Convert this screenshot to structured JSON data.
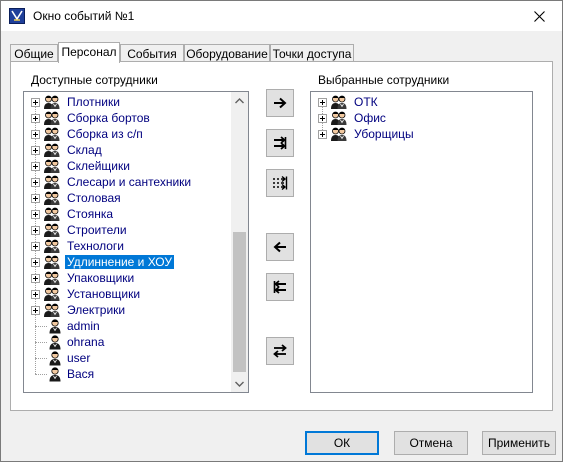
{
  "window": {
    "title": "Окно событий №1"
  },
  "tabs": [
    {
      "label": "Общие"
    },
    {
      "label": "Персонал"
    },
    {
      "label": "События"
    },
    {
      "label": "Оборудование"
    },
    {
      "label": "Точки доступа"
    }
  ],
  "active_tab": "Персонал",
  "available": {
    "label": "Доступные сотрудники",
    "groups": [
      {
        "label": "Плотники"
      },
      {
        "label": "Сборка бортов"
      },
      {
        "label": "Сборка из с/п"
      },
      {
        "label": "Склад"
      },
      {
        "label": "Склейщики"
      },
      {
        "label": "Слесари и сантехники"
      },
      {
        "label": "Столовая"
      },
      {
        "label": "Стоянка"
      },
      {
        "label": "Строители"
      },
      {
        "label": "Технологи"
      },
      {
        "label": "Удлиннение и ХОУ"
      },
      {
        "label": "Упаковщики"
      },
      {
        "label": "Установщики"
      },
      {
        "label": "Электрики"
      }
    ],
    "users": [
      {
        "label": "admin"
      },
      {
        "label": "ohrana"
      },
      {
        "label": "user"
      },
      {
        "label": "Вася"
      }
    ],
    "selected_item": "Удлиннение и ХОУ"
  },
  "selected": {
    "label": "Выбранные сотрудники",
    "groups": [
      {
        "label": "ОТК"
      },
      {
        "label": "Офис"
      },
      {
        "label": "Уборщицы"
      }
    ]
  },
  "transfer_buttons": [
    {
      "icon": "arrow-right-icon"
    },
    {
      "icon": "move-all-right-icon"
    },
    {
      "icon": "move-tree-right-icon"
    },
    {
      "icon": "arrow-left-icon"
    },
    {
      "icon": "move-all-left-icon"
    },
    {
      "icon": "swap-icon"
    }
  ],
  "buttons": {
    "ok": "ОК",
    "cancel": "Отмена",
    "apply": "Применить"
  },
  "colors": {
    "item_text": "#00007f",
    "selection": "#0078d7",
    "accent": "#0078d7"
  }
}
